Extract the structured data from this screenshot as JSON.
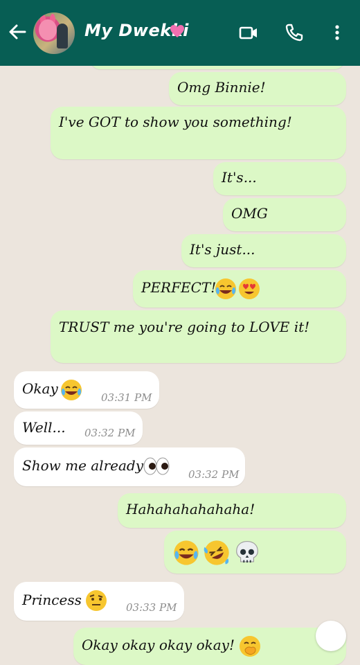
{
  "header": {
    "title": "My Dwekki"
  },
  "messages": [
    {
      "text": "Omg Binnie!"
    },
    {
      "text": "I've GOT to show you something!"
    },
    {
      "text": "It's..."
    },
    {
      "text": "OMG"
    },
    {
      "text": "It's just..."
    },
    {
      "text": "PERFECT!"
    },
    {
      "text": "TRUST me you're going to LOVE it!"
    },
    {
      "text": "Okay",
      "time": "03:31 PM"
    },
    {
      "text": "Well...",
      "time": "03:32 PM"
    },
    {
      "text": "Show me already",
      "time": "03:32 PM"
    },
    {
      "text": "Hahahahahahaha!"
    },
    {
      "text": ""
    },
    {
      "text": "Princess",
      "time": "03:33 PM"
    },
    {
      "text": "Okay okay okay okay!"
    }
  ],
  "colors": {
    "header": "#075e54",
    "outgoing_bubble": "#dcf8c6",
    "incoming_bubble": "#ffffff",
    "background": "#ece5dd"
  }
}
